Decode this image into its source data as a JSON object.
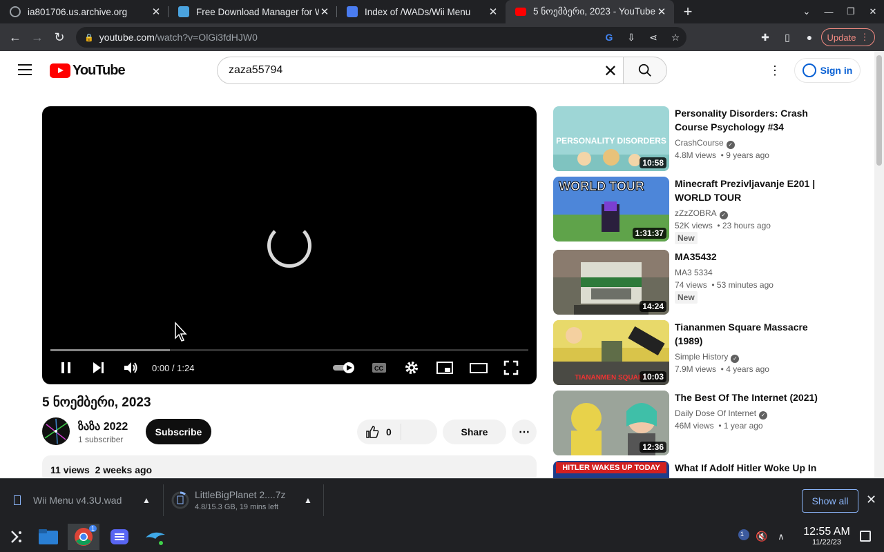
{
  "browser": {
    "tabs": [
      {
        "title": "ia801706.us.archive.org",
        "active": false
      },
      {
        "title": "Free Download Manager for Windows",
        "active": false
      },
      {
        "title": "Index of /WADs/Wii Menu",
        "active": false
      },
      {
        "title": "5 ნოემბერი, 2023 - YouTube",
        "active": true
      }
    ],
    "url_host": "youtube.com",
    "url_path": "/watch?v=OlGi3fdHJW0",
    "update_label": "Update"
  },
  "youtube": {
    "logo_text": "YouTube",
    "search_value": "zaza55794",
    "sign_in_label": "Sign in"
  },
  "player": {
    "time": "0:00 / 1:24",
    "progress_buffered": 0.25
  },
  "video": {
    "title": "5 ნოემბერი, 2023",
    "channel": "ზაზა 2022",
    "subscribers": "1 subscriber",
    "subscribe_label": "Subscribe",
    "likes": "0",
    "share_label": "Share",
    "views_date": "11 views  2 weeks ago"
  },
  "related": [
    {
      "title": "Personality Disorders: Crash Course Psychology #34",
      "channel": "CrashCourse",
      "verified": true,
      "meta": "4.8M views  • 9 years ago",
      "duration": "10:58",
      "new": false,
      "thumb_color": "#9ed6d6"
    },
    {
      "title": "Minecraft Prezivljavanje E201 | WORLD TOUR",
      "channel": "zZzZOBRA",
      "verified": true,
      "meta": "52K views  • 23 hours ago",
      "duration": "1:31:37",
      "new": true,
      "thumb_color": "#4d86d9"
    },
    {
      "title": "MA35432",
      "channel": "MA3 5334",
      "verified": false,
      "meta": "74 views  • 53 minutes ago",
      "duration": "14:24",
      "new": true,
      "thumb_color": "#6b6a5c"
    },
    {
      "title": "Tiananmen Square Massacre (1989)",
      "channel": "Simple History",
      "verified": true,
      "meta": "7.9M views  • 4 years ago",
      "duration": "10:03",
      "new": false,
      "thumb_color": "#d9c44a"
    },
    {
      "title": "The Best Of The Internet (2021)",
      "channel": "Daily Dose Of Internet",
      "verified": true,
      "meta": "46M views  • 1 year ago",
      "duration": "12:36",
      "new": false,
      "thumb_color": "#8a8f86"
    },
    {
      "title": "What If Adolf Hitler Woke Up In",
      "banner": "HITLER WAKES UP TODAY",
      "thumb_color": "#1d3d8a"
    }
  ],
  "new_badge": "New",
  "downloads": {
    "items": [
      {
        "name": "Wii Menu v4.3U.wad",
        "status": ""
      },
      {
        "name": "LittleBigPlanet 2....7z",
        "status": "4.8/15.3 GB, 19 mins left"
      }
    ],
    "show_all_label": "Show all"
  },
  "taskbar": {
    "time": "12:55 AM",
    "date": "11/22/23",
    "chrome_badge": "1",
    "tray_badge": "1"
  },
  "colors": {
    "yt_red": "#ff0000",
    "chrome_dark": "#202124",
    "link_blue": "#065fd4"
  }
}
